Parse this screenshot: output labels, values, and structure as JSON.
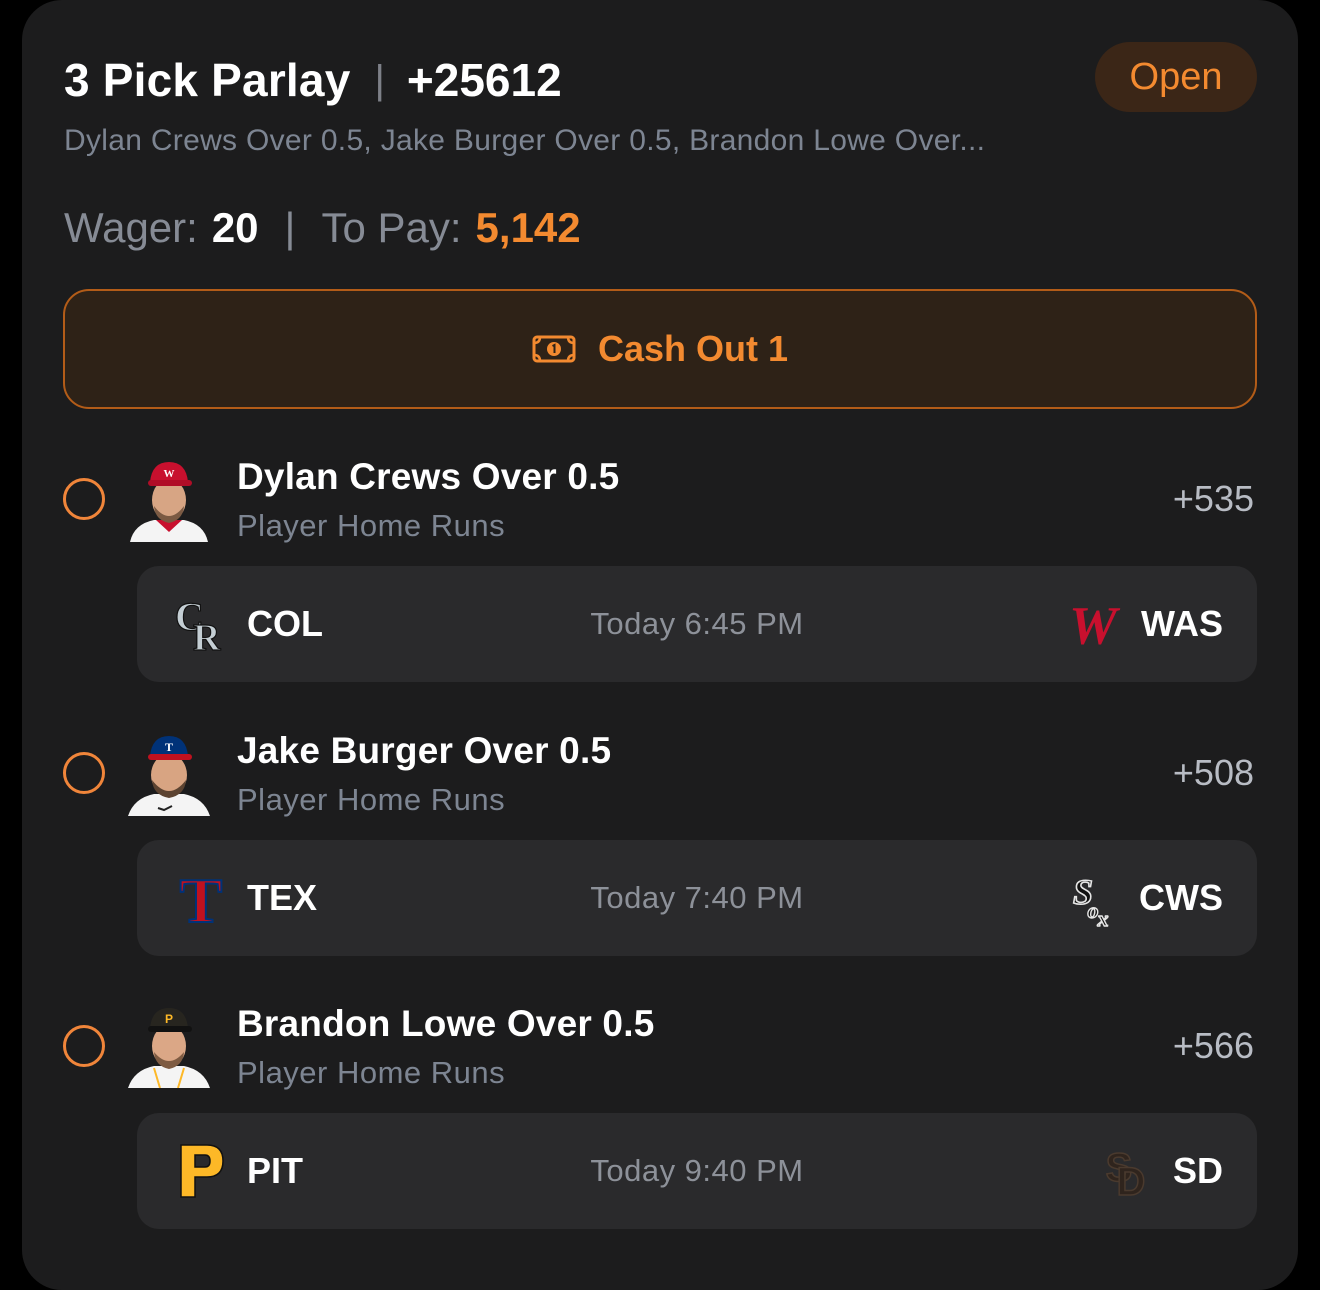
{
  "bet": {
    "title": "3 Pick Parlay",
    "separator": "|",
    "odds": "+25612",
    "status": "Open",
    "legs_summary": "Dylan Crews Over 0.5, Jake Burger Over 0.5, Brandon Lowe Over...",
    "wager_label": "Wager:",
    "wager_value": "20",
    "to_pay_label": "To Pay:",
    "to_pay_value": "5,142",
    "cashout_label": "Cash Out 1"
  },
  "colors": {
    "accent": "#f38a30",
    "card_bg": "#1c1c1d",
    "game_bg": "#2a2a2c",
    "muted_text": "#7d8592"
  },
  "legs": [
    {
      "title": "Dylan Crews Over 0.5",
      "market": "Player Home Runs",
      "odds": "+535",
      "player_cap_color": "#c8102e",
      "away": {
        "abbr": "COL",
        "logo": "rockies-logo"
      },
      "time": "Today 6:45 PM",
      "home": {
        "abbr": "WAS",
        "logo": "nationals-logo"
      }
    },
    {
      "title": "Jake Burger Over 0.5",
      "market": "Player Home Runs",
      "odds": "+508",
      "player_cap_color": "#003278",
      "away": {
        "abbr": "TEX",
        "logo": "rangers-logo"
      },
      "time": "Today 7:40 PM",
      "home": {
        "abbr": "CWS",
        "logo": "white-sox-logo"
      }
    },
    {
      "title": "Brandon Lowe Over 0.5",
      "market": "Player Home Runs",
      "odds": "+566",
      "player_cap_color": "#27251f",
      "away": {
        "abbr": "PIT",
        "logo": "pirates-logo"
      },
      "time": "Today 9:40 PM",
      "home": {
        "abbr": "SD",
        "logo": "padres-logo"
      }
    }
  ]
}
